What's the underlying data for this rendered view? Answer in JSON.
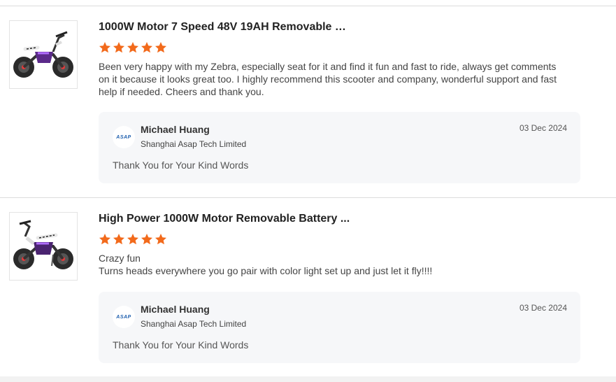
{
  "reviews": [
    {
      "product_title": "1000W Motor 7 Speed 48V 19AH Removable B...",
      "rating": 5,
      "text": "Been very happy with my Zebra, especially seat for it and find it fun and fast to ride, always get comments on it because it looks great too. I highly recommend this scooter and company, wonderful support and fast help if needed. Cheers and thank you.",
      "reply": {
        "avatar_text": "ASAP",
        "name": "Michael Huang",
        "company": "Shanghai Asap Tech Limited",
        "date": "03 Dec 2024",
        "text": "Thank You for Your Kind Words"
      }
    },
    {
      "product_title": "High Power 1000W Motor Removable Battery ...",
      "rating": 5,
      "text_lines": [
        "Crazy fun",
        "Turns heads everywhere you go pair with color light set up and just let it fly!!!!"
      ],
      "reply": {
        "avatar_text": "ASAP",
        "name": "Michael Huang",
        "company": "Shanghai Asap Tech Limited",
        "date": "03 Dec 2024",
        "text": "Thank You for Your Kind Words"
      }
    }
  ],
  "colors": {
    "star": "#f26a1b",
    "reply_bg": "#f6f7f9",
    "divider": "#dcdcdc",
    "logo_blue": "#1f5fae"
  }
}
